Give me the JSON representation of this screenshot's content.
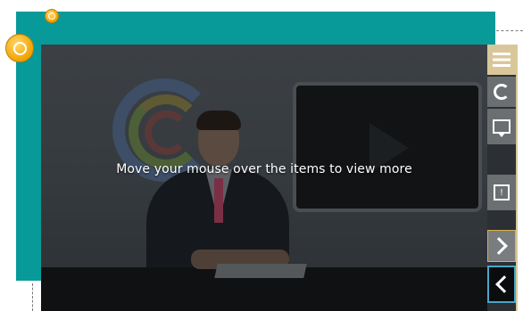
{
  "stage": {
    "overlay_text": "Move your mouse over the items to view more"
  },
  "markers": [
    {
      "name": "hotspot-marker-small"
    },
    {
      "name": "hotspot-marker-large"
    }
  ],
  "nav": {
    "menu_icon": "menu-icon",
    "reload_icon": "reload-icon",
    "comment_icon": "comment-icon",
    "info_icon": "info-icon",
    "info_glyph": "!",
    "next_icon": "chevron-right-icon",
    "prev_icon": "chevron-left-icon"
  },
  "colors": {
    "frame": "#089a99",
    "marker": "#f2a200",
    "active_outline": "#4aa6c8",
    "nav_highlight": "#d9c79a"
  }
}
